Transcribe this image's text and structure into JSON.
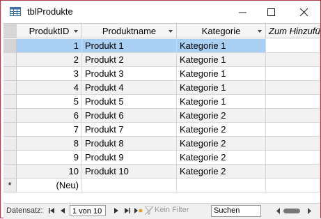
{
  "window": {
    "title": "tblProdukte",
    "buttons": [
      "minimize",
      "maximize",
      "close"
    ]
  },
  "table": {
    "columns": [
      {
        "label": "ProduktID",
        "dropdown": true
      },
      {
        "label": "Produktname",
        "dropdown": true
      },
      {
        "label": "Kategorie",
        "dropdown": true
      },
      {
        "label": "Zum Hinzufügen klicken",
        "dropdown": false
      }
    ],
    "rows": [
      {
        "id": "1",
        "name": "Produkt 1",
        "category": "Kategorie 1"
      },
      {
        "id": "2",
        "name": "Produkt 2",
        "category": "Kategorie 1"
      },
      {
        "id": "3",
        "name": "Produkt 3",
        "category": "Kategorie 1"
      },
      {
        "id": "4",
        "name": "Produkt 4",
        "category": "Kategorie 1"
      },
      {
        "id": "5",
        "name": "Produkt 5",
        "category": "Kategorie 1"
      },
      {
        "id": "6",
        "name": "Produkt 6",
        "category": "Kategorie 2"
      },
      {
        "id": "7",
        "name": "Produkt 7",
        "category": "Kategorie 2"
      },
      {
        "id": "8",
        "name": "Produkt 8",
        "category": "Kategorie 2"
      },
      {
        "id": "9",
        "name": "Produkt 9",
        "category": "Kategorie 2"
      },
      {
        "id": "10",
        "name": "Produkt 10",
        "category": "Kategorie 2"
      }
    ],
    "new_row": {
      "marker": "*",
      "id": "(Neu)"
    },
    "current_row": 0
  },
  "navigation": {
    "label": "Datensatz:",
    "record": "1 von 10",
    "filter": "Kein Filter",
    "search_placeholder": "Suchen"
  },
  "colors": {
    "window_border": "#b03a45",
    "selection": "#a9cff2",
    "alt_row": "#f2f2f2"
  }
}
